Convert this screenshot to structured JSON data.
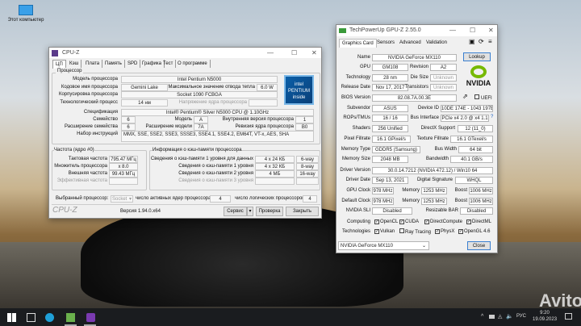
{
  "desktop": {
    "icon_label": "Этот компьютер",
    "watermark": "Avito"
  },
  "taskbar": {
    "lang": "РУС",
    "time": "9:20",
    "date": "19.09.2023"
  },
  "cpuz": {
    "title": "CPU-Z",
    "tabs": [
      "ЦП",
      "Кэш",
      "Плата",
      "Память",
      "SPD",
      "Графика",
      "Тест",
      "О программе"
    ],
    "processor_group": "Процессор",
    "labels": {
      "model": "Модель процессора",
      "codename": "Кодовое имя процессора",
      "package": "Корпусировка процессора",
      "technology": "Технологический процесс",
      "tdp": "Максимальное значение отвода тепла",
      "voltage": "Напряжение ядра процессора",
      "spec": "Спецификация",
      "family": "Семейство",
      "model_short": "Модель",
      "stepping": "Внутренняя версия процессора",
      "ext_family": "Расширение семейства",
      "ext_model": "Расширение модели",
      "revision": "Ревизия ядра процессора",
      "instructions": "Набор инструкций"
    },
    "values": {
      "model": "Intel Pentium N5000",
      "codename": "Gemini Lake",
      "tdp": "6.0 W",
      "package": "Socket 1090 FCBGA",
      "technology": "14 нм",
      "voltage": "",
      "spec": "Intel® Pentium® Silver N5000 CPU @ 1.10GHz",
      "family": "6",
      "model_short": "A",
      "stepping": "1",
      "ext_family": "6",
      "ext_model": "7A",
      "revision": "B0",
      "instructions": "MMX, SSE, SSE2, SSE3, SSSE3, SSE4.1, SSE4.2, EM64T, VT-x, AES, SHA"
    },
    "logo": {
      "brand": "intel",
      "line": "PENTIUM",
      "sub": "inside"
    },
    "clocks_group": "Частота (ядро #0)",
    "clocks": [
      {
        "label": "Тактовая частота",
        "value": "795.47 МГц"
      },
      {
        "label": "Множитель процессора",
        "value": "x 8.0"
      },
      {
        "label": "Внешняя частота",
        "value": "99.43 МГц"
      },
      {
        "label": "Эффективная частота",
        "value": ""
      }
    ],
    "cache_group": "Информация о кэш-памяти процессора",
    "cache": [
      {
        "label": "Сведения о кэш-памяти 1 уровня для данных",
        "size": "4 x 24 КБ",
        "way": "6-way"
      },
      {
        "label": "Сведения о кэш-памяти 1 уровня",
        "size": "4 x 32 КБ",
        "way": "8-way"
      },
      {
        "label": "Сведения о кэш-памяти 2 уровня",
        "size": "4 МБ",
        "way": "16-way"
      },
      {
        "label": "Сведения о кэш-памяти 3 уровня",
        "size": "",
        "way": ""
      }
    ],
    "selected_label": "Выбранный процессор:",
    "selected_value": "Socket",
    "active_cores_label": "число активных ядер процессора",
    "active_cores": "4",
    "logical_label": "число логических процессоров",
    "logical": "4",
    "brand": "CPU-Z",
    "version": "Версия 1.94.0.x64",
    "tools_btn": "Сервис",
    "validate_btn": "Проверка",
    "close_btn": "Закрыть"
  },
  "gpuz": {
    "title": "TechPowerUp GPU-Z 2.55.0",
    "tabs": [
      "Graphics Card",
      "Sensors",
      "Advanced",
      "Validation"
    ],
    "lookup": "Lookup",
    "uefi": "UEFI",
    "vendor_logo": "NVIDIA",
    "l": {
      "name": "Name",
      "gpu": "GPU",
      "revision": "Revision",
      "technology": "Technology",
      "die": "Die Size",
      "release": "Release Date",
      "transistors": "Transistors",
      "bios": "BIOS Version",
      "subvendor": "Subvendor",
      "device": "Device ID",
      "rops": "ROPs/TMUs",
      "bus": "Bus Interface",
      "shaders": "Shaders",
      "directx": "DirectX Support",
      "pixel": "Pixel Fillrate",
      "texture": "Texture Fillrate",
      "memtype": "Memory Type",
      "buswidth": "Bus Width",
      "memsize": "Memory Size",
      "bandwidth": "Bandwidth",
      "drvver": "Driver Version",
      "drvdate": "Driver Date",
      "sig": "Digital Signature",
      "gpuclock": "GPU Clock",
      "memory": "Memory",
      "boost": "Boost",
      "defclock": "Default Clock",
      "sli": "NVIDIA SLI",
      "rebar": "Resizable BAR",
      "computing": "Computing",
      "tech": "Technologies"
    },
    "v": {
      "name": "NVIDIA GeForce MX110",
      "gpu": "GM108",
      "revision": "A2",
      "technology": "28 nm",
      "die": "Unknown",
      "release": "Nov 17, 2017",
      "transistors": "Unknown",
      "bios": "82.08.7A.00.3E",
      "subvendor": "ASUS",
      "device": "10DE 174E - 1043 197E",
      "rops": "16 / 16",
      "bus": "PCIe x4 2.0 @ x4 1.1",
      "shaders": "256 Unified",
      "directx": "12 (11_0)",
      "pixel": "16.1 GPixel/s",
      "texture": "16.1 GTexel/s",
      "memtype": "GDDR5 (Samsung)",
      "buswidth": "64 bit",
      "memsize": "2048 MB",
      "bandwidth": "40.1 GB/s",
      "drvver": "30.0.14.7212 (NVIDIA 472.12) / Win10 64",
      "drvdate": "Sep 13, 2021",
      "sig": "WHQL",
      "gpuclock": "978 MHz",
      "gpumem": "1253 MHz",
      "gpuboost": "1006 MHz",
      "defclock": "978 MHz",
      "defmem": "1253 MHz",
      "defboost": "1006 MHz",
      "sli": "Disabled",
      "rebar": "Disabled"
    },
    "computing": [
      {
        "label": "OpenCL",
        "checked": true
      },
      {
        "label": "CUDA",
        "checked": true
      },
      {
        "label": "DirectCompute",
        "checked": true
      },
      {
        "label": "DirectML",
        "checked": true
      }
    ],
    "technologies": [
      {
        "label": "Vulkan",
        "checked": true
      },
      {
        "label": "Ray Tracing",
        "checked": false
      },
      {
        "label": "PhysX",
        "checked": true
      },
      {
        "label": "OpenGL 4.6",
        "checked": true
      }
    ],
    "selected_gpu": "NVIDIA GeForce MX110",
    "close": "Close"
  }
}
